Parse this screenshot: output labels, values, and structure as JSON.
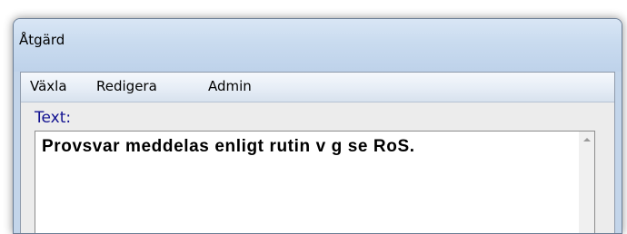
{
  "window": {
    "title": "Åtgärd"
  },
  "menu": {
    "items": [
      "Växla",
      "Redigera",
      "Admin"
    ]
  },
  "text_field": {
    "label": "Text:",
    "value": "Provsvar meddelas enligt rutin v g se RoS."
  },
  "icons": {
    "scroll_up": "chevron-up-icon"
  },
  "colors": {
    "label_text": "#101090",
    "titlebar": "#c9dbef"
  }
}
